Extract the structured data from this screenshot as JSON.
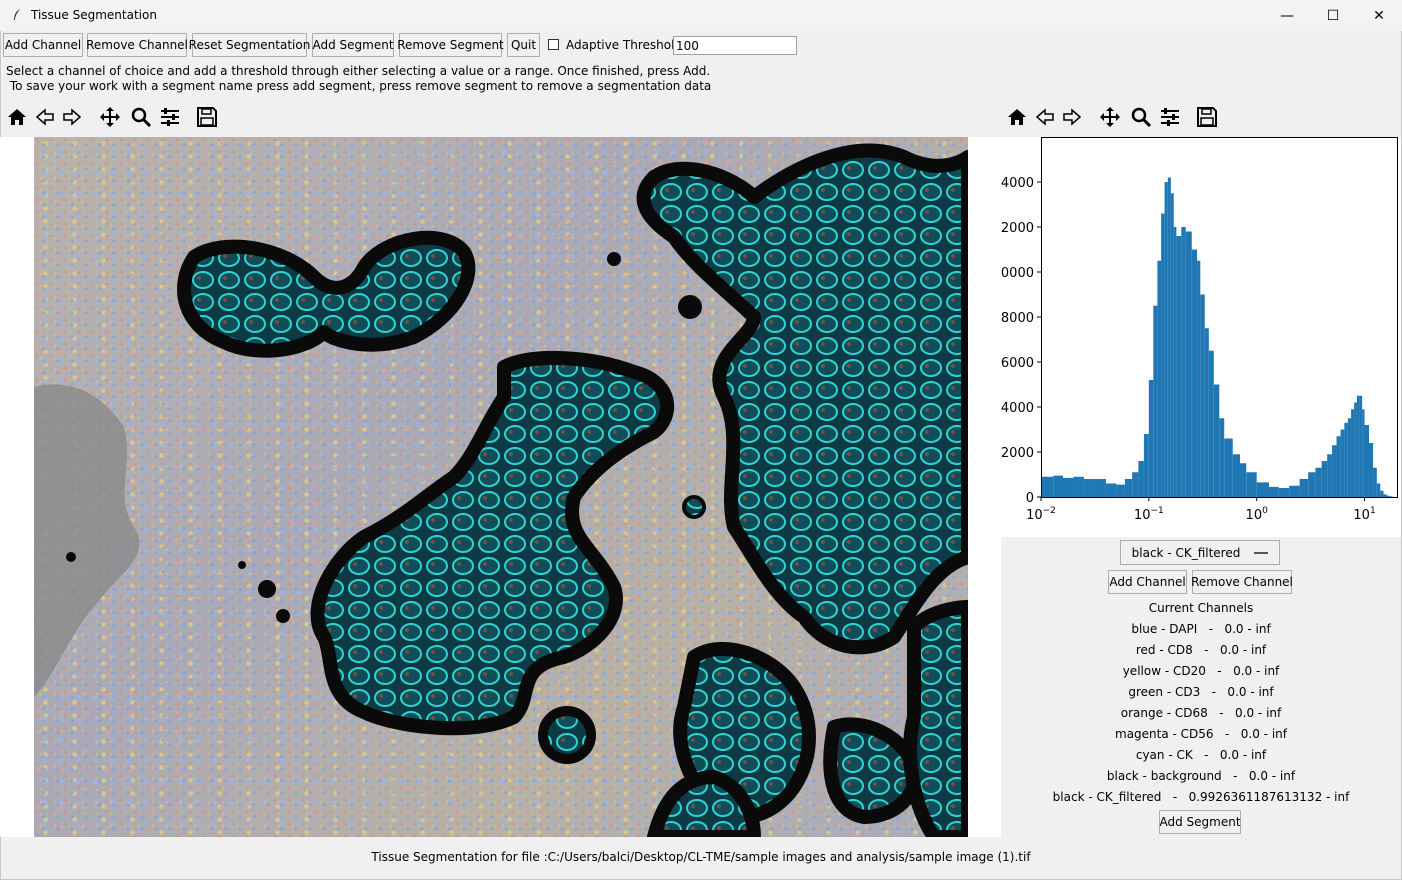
{
  "window": {
    "title": "Tissue Segmentation",
    "minimize_glyph": "—",
    "maximize_glyph": "☐",
    "close_glyph": "✕"
  },
  "toolbar": {
    "add_channel": "Add Channel",
    "remove_channel": "Remove Channel",
    "reset_segmentation": "Reset Segmentation",
    "add_segment": "Add Segment",
    "remove_segment": "Remove Segment",
    "quit": "Quit",
    "adaptive_threshold_label": "Adaptive Threshold",
    "adaptive_threshold_checked": false,
    "threshold_value": "100"
  },
  "instructions": {
    "line1": "Select a channel of choice and add a threshold through either selecting a value or a range. Once finished, press Add.",
    "line2": " To save your work with a segment name press add segment, press remove segment to remove a segmentation data"
  },
  "nav_icons": [
    "home-icon",
    "back-arrow-icon",
    "forward-arrow-icon",
    "pan-icon",
    "zoom-icon",
    "configure-icon",
    "save-icon"
  ],
  "histogram": {
    "y_ticks": [
      "4000",
      "2000",
      "0000",
      "8000",
      "6000",
      "4000",
      "2000",
      "0"
    ],
    "x_ticks": [
      {
        "base": "10",
        "exp": "−2"
      },
      {
        "base": "10",
        "exp": "−1"
      },
      {
        "base": "10",
        "exp": "0"
      },
      {
        "base": "10",
        "exp": "1"
      }
    ],
    "bar_color": "#1f77b4"
  },
  "chart_data": {
    "type": "bar",
    "x_scale": "log",
    "xlim": [
      0.01,
      20
    ],
    "ylim": [
      0,
      16000
    ],
    "x": [
      0.01,
      0.013,
      0.016,
      0.02,
      0.025,
      0.03,
      0.04,
      0.05,
      0.06,
      0.07,
      0.08,
      0.09,
      0.1,
      0.11,
      0.12,
      0.13,
      0.14,
      0.15,
      0.16,
      0.17,
      0.18,
      0.2,
      0.22,
      0.25,
      0.28,
      0.3,
      0.33,
      0.36,
      0.4,
      0.45,
      0.5,
      0.6,
      0.7,
      0.8,
      1.0,
      1.3,
      1.6,
      2.0,
      2.5,
      3.0,
      3.5,
      4.0,
      4.5,
      5.0,
      5.5,
      6.0,
      6.5,
      7.0,
      7.5,
      8.0,
      8.5,
      9.0,
      9.5,
      10.0,
      11.0,
      12.0,
      13.0,
      14.0,
      15.0,
      16.0,
      17.0,
      18.0,
      19.0
    ],
    "values": [
      900,
      950,
      850,
      900,
      800,
      800,
      600,
      550,
      800,
      1100,
      1600,
      2800,
      5200,
      8500,
      10500,
      12600,
      14000,
      14200,
      13500,
      12000,
      11600,
      12000,
      11800,
      11000,
      10500,
      9000,
      7500,
      6500,
      5000,
      3500,
      2600,
      1900,
      1500,
      1100,
      650,
      450,
      400,
      500,
      800,
      1100,
      1300,
      1600,
      1900,
      2300,
      2700,
      3000,
      3300,
      3500,
      3900,
      4200,
      4500,
      4500,
      3900,
      3200,
      2400,
      1300,
      600,
      280,
      120,
      60,
      30,
      10,
      0
    ]
  },
  "controls": {
    "selected_channel": "black - CK_filtered",
    "add_channel": "Add Channel",
    "remove_channel": "Remove Channel",
    "current_channels_title": "Current Channels",
    "channels": [
      "blue - DAPI   -   0.0 - inf",
      "red - CD8   -   0.0 - inf",
      "yellow - CD20   -   0.0 - inf",
      "green - CD3   -   0.0 - inf",
      "orange - CD68   -   0.0 - inf",
      "magenta - CD56   -   0.0 - inf",
      "cyan - CK   -   0.0 - inf",
      "black - background   -   0.0 - inf",
      "black - CK_filtered   -   0.9926361187613132 - inf"
    ],
    "add_segment": "Add Segment"
  },
  "footer": "Tissue Segmentation for file :C:/Users/balci/Desktop/CL-TME/sample images and analysis/sample image (1).tif"
}
